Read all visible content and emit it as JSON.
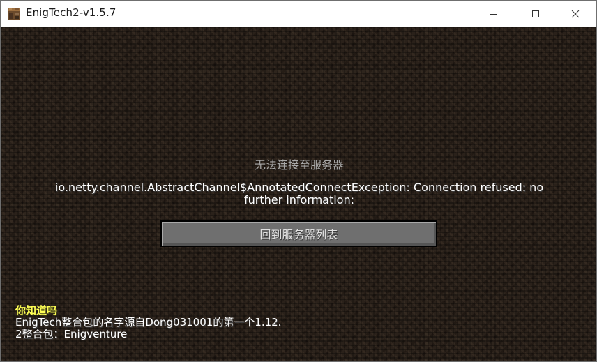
{
  "window": {
    "title": "EnigTech2-v1.5.7",
    "icon": "crafting-table-icon",
    "controls": {
      "minimize": "minimize-icon",
      "maximize": "maximize-icon",
      "close": "close-icon"
    }
  },
  "screen": {
    "title": "无法连接至服务器",
    "error_message": "io.netty.channel.AbstractChannel$AnnotatedConnectException: Connection refused: no further information:",
    "back_button_label": "回到服务器列表"
  },
  "tip": {
    "heading": "你知道吗",
    "lines": [
      "EnigTech整合包的名字源自Dong031001的第一个1.12.",
      "2整合包：Enigventure"
    ]
  },
  "colors": {
    "title_text": "#a8a8a8",
    "tip_heading": "#ffff55",
    "button_face": "#6f6f6f"
  }
}
